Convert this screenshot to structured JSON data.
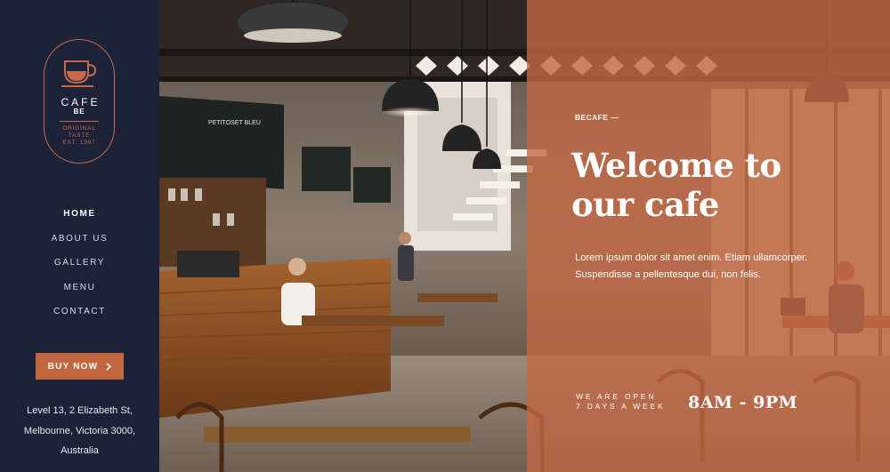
{
  "sidebar": {
    "logo": {
      "icon": "coffee-cup-icon",
      "name": "CAFE",
      "sub": "BE",
      "tagline_1": "ORIGINAL",
      "tagline_2": "TASTE",
      "tagline_3": "EST. 1997"
    },
    "nav": [
      {
        "label": "HOME",
        "active": true
      },
      {
        "label": "ABOUT US",
        "active": false
      },
      {
        "label": "GALLERY",
        "active": false
      },
      {
        "label": "MENU",
        "active": false
      },
      {
        "label": "CONTACT",
        "active": false
      }
    ],
    "buy_button": {
      "label": "BUY NOW",
      "icon": "chevron-right-icon"
    },
    "address": {
      "line_1": "Level 13, 2 Elizabeth St,",
      "line_2": "Melbourne, Victoria 3000,",
      "line_3": "Australia"
    }
  },
  "hero": {
    "brand_tag": "BECAFE —",
    "headline_1": "Welcome to",
    "headline_2": "our cafe",
    "lead": "Lorem ipsum dolor sit amet enim. Etiam ullamcorper. Suspendisse a pellentesque dui, non felis.",
    "open_line_1": "WE ARE OPEN",
    "open_line_2": "7 DAYS A WEEK",
    "hours": "8AM - 9PM",
    "menu_board_text": "PETITOSET BLEU"
  },
  "colors": {
    "sidebar_bg": "#1c2338",
    "accent": "#c1663f",
    "overlay": "#c46844",
    "text_light": "#ffffff"
  }
}
